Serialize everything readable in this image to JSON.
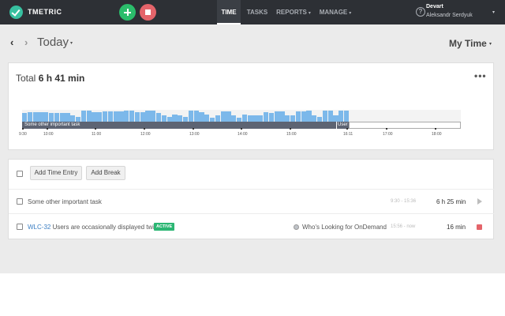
{
  "app": {
    "brand": "TMETRIC",
    "icons": {
      "logo": "tmetric-logo-icon",
      "start": "plus-icon",
      "stop": "stop-icon",
      "help": "question-icon"
    },
    "colors": {
      "topbar": "#2d3035",
      "start": "#2bbd6b",
      "stop": "#e4646a",
      "accent": "#7cb8ea",
      "active_badge": "#2bb673",
      "link": "#3a7ec2"
    }
  },
  "nav": {
    "items": [
      {
        "label": "TIME",
        "active": true,
        "caret": ""
      },
      {
        "label": "TASKS",
        "active": false,
        "caret": ""
      },
      {
        "label": "REPORTS",
        "active": false,
        "caret": "▾"
      },
      {
        "label": "MANAGE",
        "active": false,
        "caret": "▾"
      }
    ]
  },
  "account": {
    "org": "Devart",
    "user": "Aleksandr Serdyuk",
    "caret": "▾"
  },
  "header": {
    "prev": "‹",
    "next": "›",
    "title": "Today",
    "title_caret": "▾",
    "view": "My Time",
    "view_caret": "▾"
  },
  "summary": {
    "total_label": "Total",
    "total_value": "6 h 41 min",
    "more": "•••",
    "timeline": {
      "track_label": "Some other important task",
      "track2_label": "User",
      "tick_labels": [
        "9:30",
        "10:00",
        "11:00",
        "12:00",
        "13:00",
        "14:00",
        "15:00",
        "16:11",
        "17:00",
        "18:00"
      ],
      "activity_levels": [
        0.75,
        0.8,
        0.8,
        0.8,
        0.8,
        0.7,
        0.7,
        0.75,
        0.7,
        0.5,
        0.4,
        0.9,
        0.9,
        0.8,
        0.8,
        0.85,
        0.85,
        0.85,
        0.85,
        0.9,
        0.9,
        0.8,
        0.8,
        0.9,
        0.9,
        0.7,
        0.5,
        0.4,
        0.6,
        0.5,
        0.4,
        0.9,
        0.9,
        0.8,
        0.6,
        0.3,
        0.5,
        0.85,
        0.85,
        0.5,
        0.3,
        0.6,
        0.55,
        0.55,
        0.55,
        0.8,
        0.75,
        0.85,
        0.85,
        0.55,
        0.55,
        0.85,
        0.85,
        0.9,
        0.55,
        0.4,
        0.9,
        0.95,
        0.5,
        0.9,
        0.9
      ]
    }
  },
  "entries": {
    "add_time_label": "Add Time Entry",
    "add_break_label": "Add Break",
    "rows": [
      {
        "task_id": "",
        "description": "Some other important task",
        "badge": "",
        "project": "",
        "time_range": "9:30 - 15:36",
        "duration": "6 h 25 min",
        "action": "play-icon"
      },
      {
        "task_id": "WLC-32",
        "description": "Users are occasionally displayed twice",
        "badge": "ACTIVE",
        "project": "Who's Looking for OnDemand",
        "time_range": "15:56 - now",
        "duration": "16 min",
        "action": "stop-icon"
      }
    ]
  }
}
